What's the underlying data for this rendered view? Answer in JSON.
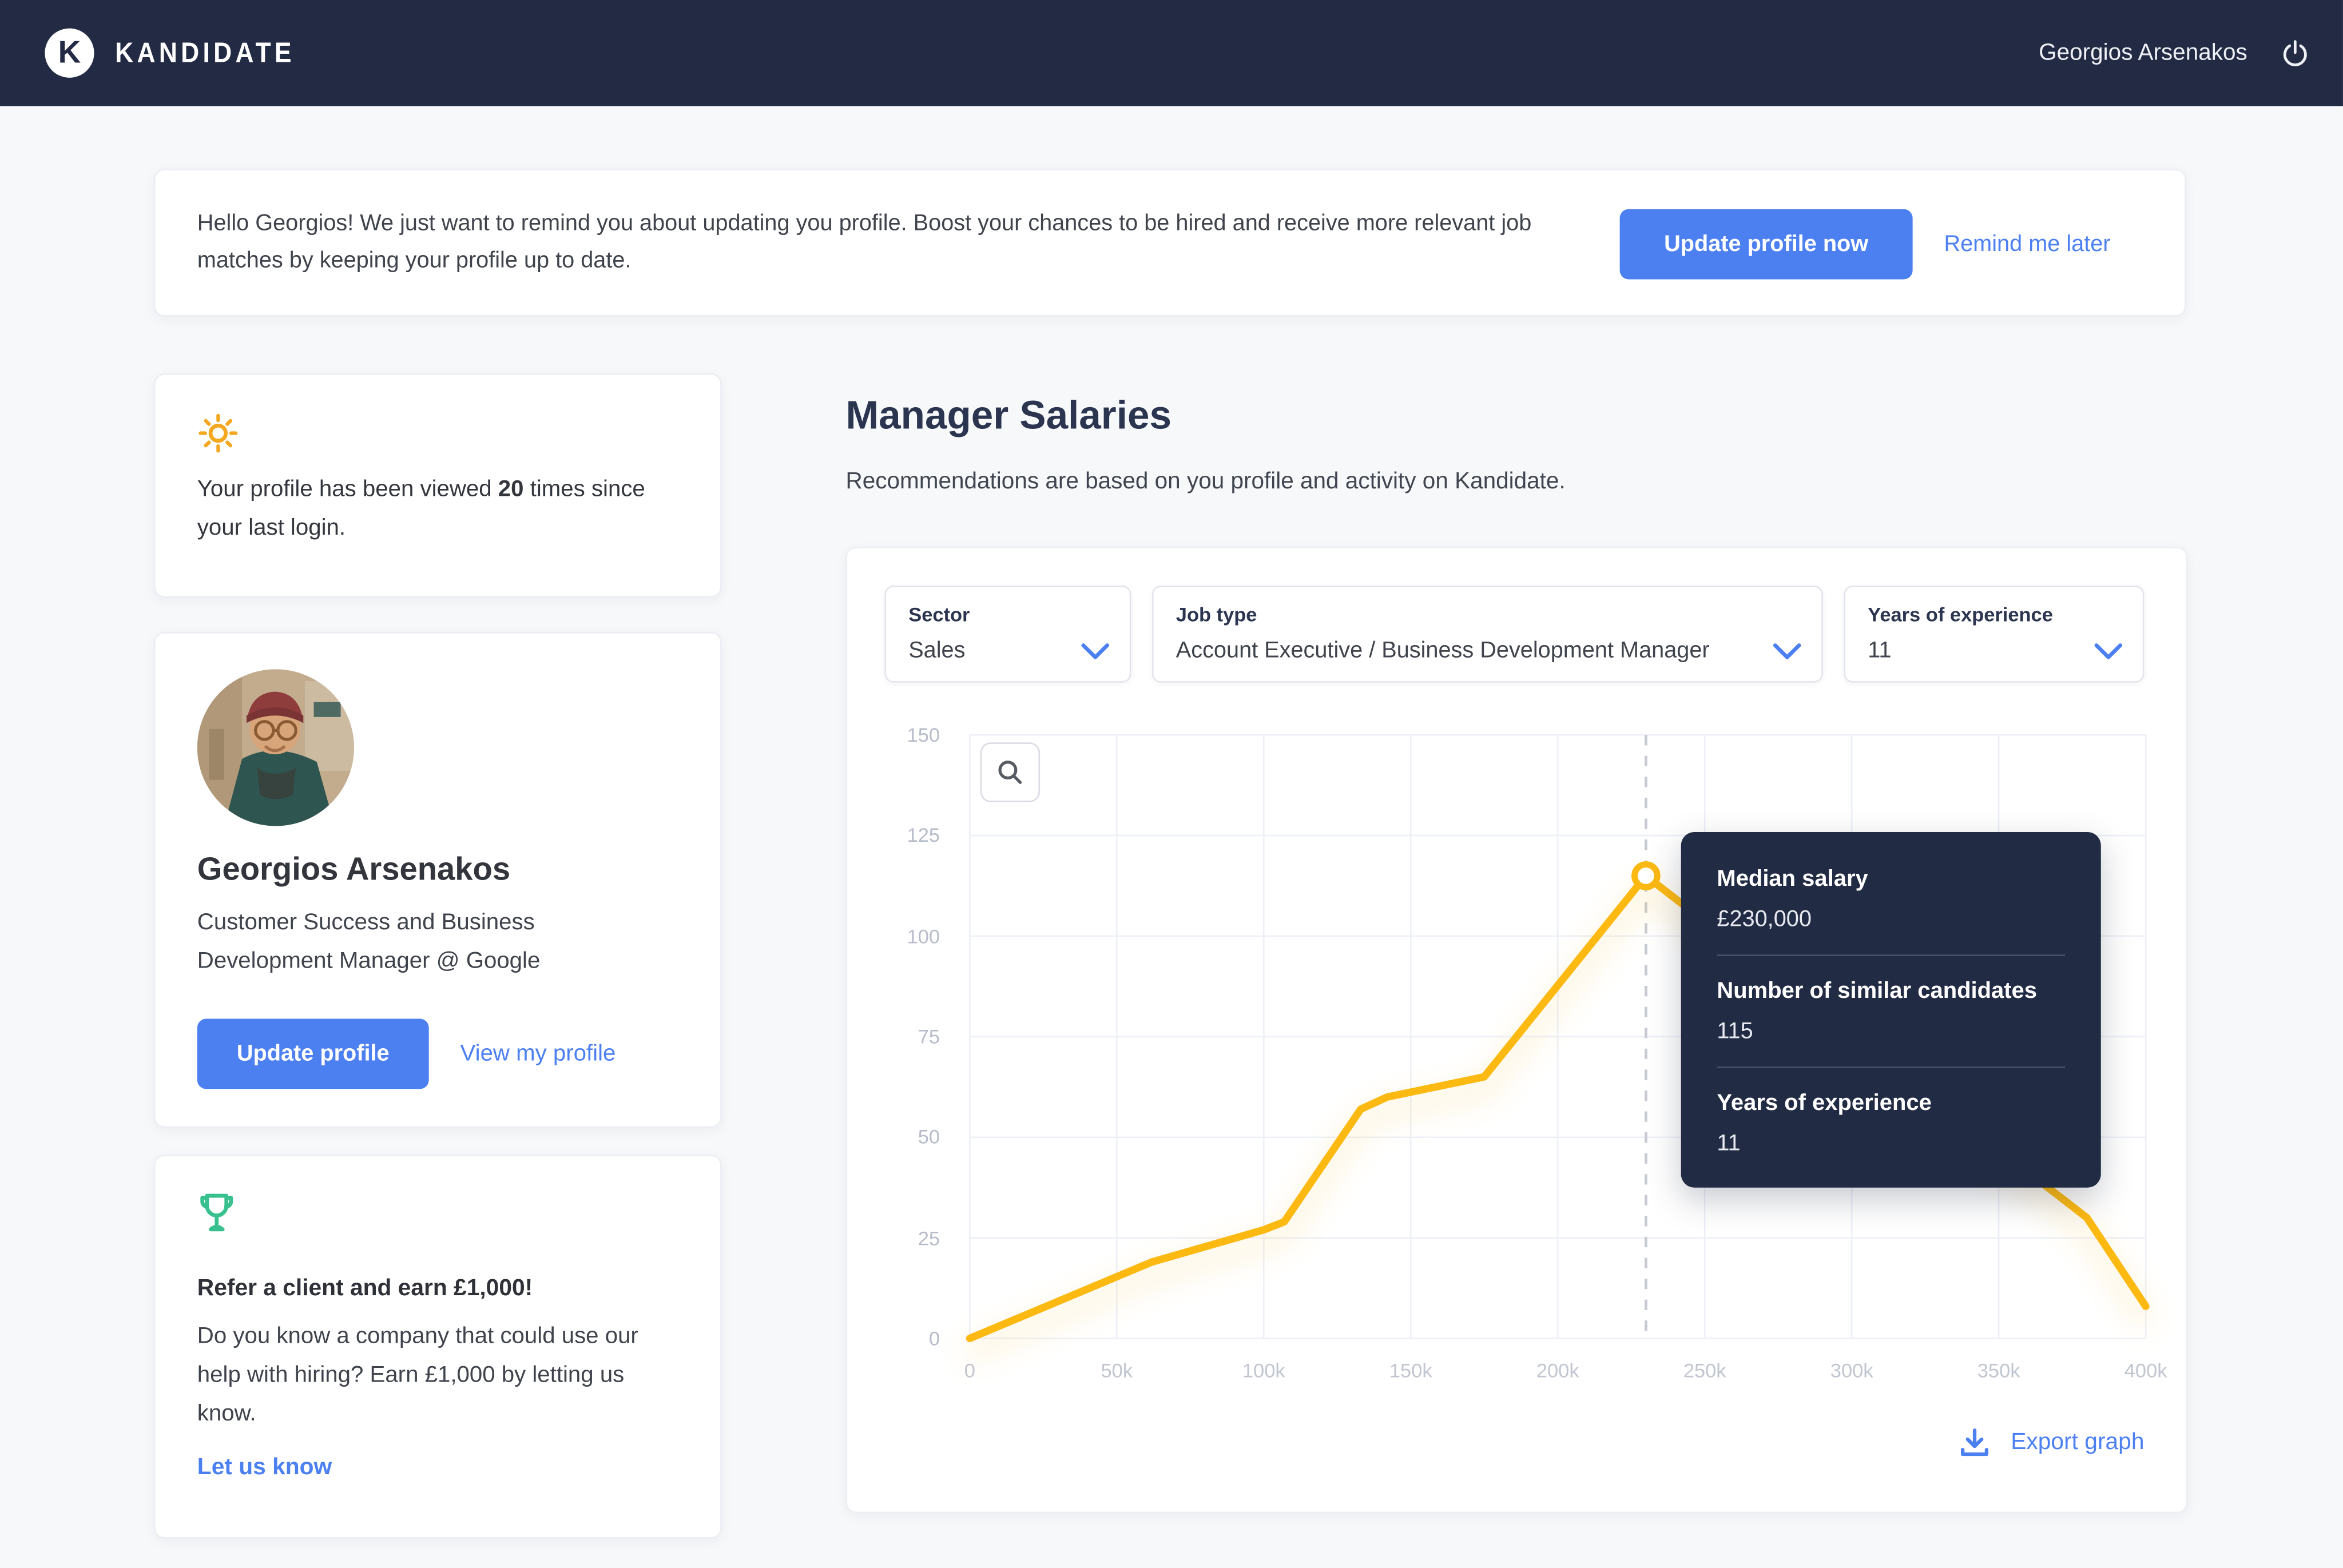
{
  "colors": {
    "navy": "#232b44",
    "accent_blue": "#4c80f1",
    "line_yellow": "#fcb912",
    "sun_orange": "#f3a81f",
    "trophy_green": "#38c18e"
  },
  "navbar": {
    "logo_letter": "K",
    "brand": "KANDIDATE",
    "user_name": "Georgios Arsenakos"
  },
  "banner": {
    "message": "Hello Georgios! We just want to remind you about updating you profile. Boost your chances to be hired and receive more relevant job matches by keeping your profile up to date.",
    "primary_button": "Update profile now",
    "secondary_link": "Remind me later"
  },
  "sidebar": {
    "views_card": {
      "text_before": "Your profile has been viewed ",
      "count": "20",
      "text_after": " times since your last login."
    },
    "profile_card": {
      "name": "Georgios Arsenakos",
      "title": "Customer Success and Business Development Manager @ Google",
      "primary_button": "Update profile",
      "secondary_link": "View my profile"
    },
    "referral_card": {
      "title": "Refer a client and earn £1,000!",
      "body": "Do you know a company that could use our help with hiring? Earn £1,000 by letting us know.",
      "link": "Let us know"
    }
  },
  "main": {
    "title": "Manager Salaries",
    "subtitle": "Recommendations are based on you profile and activity on Kandidate.",
    "filters": [
      {
        "label": "Sector",
        "value": "Sales"
      },
      {
        "label": "Job type",
        "value": "Account Executive / Business Development Manager"
      },
      {
        "label": "Years of experience",
        "value": "11"
      }
    ],
    "tooltip": {
      "rows": [
        {
          "label": "Median salary",
          "value": "£230,000"
        },
        {
          "label": "Number of similar candidates",
          "value": "115"
        },
        {
          "label": "Years of experience",
          "value": "11"
        }
      ]
    },
    "export_label": "Export graph"
  },
  "chart_data": {
    "type": "line",
    "title": "Manager Salaries",
    "x_ticks": [
      {
        "value": 0,
        "label": "0"
      },
      {
        "value": 50000,
        "label": "50k"
      },
      {
        "value": 100000,
        "label": "100k"
      },
      {
        "value": 150000,
        "label": "150k"
      },
      {
        "value": 200000,
        "label": "200k"
      },
      {
        "value": 250000,
        "label": "250k"
      },
      {
        "value": 300000,
        "label": "300k"
      },
      {
        "value": 350000,
        "label": "350k"
      },
      {
        "value": 400000,
        "label": "400k"
      }
    ],
    "y_ticks": [
      0,
      25,
      50,
      75,
      100,
      125,
      150
    ],
    "x_range": [
      0,
      400000
    ],
    "y_range": [
      0,
      150
    ],
    "grid": true,
    "legend": false,
    "points": [
      [
        0,
        0
      ],
      [
        62000,
        19
      ],
      [
        100000,
        27
      ],
      [
        107000,
        29
      ],
      [
        133000,
        57
      ],
      [
        142000,
        60
      ],
      [
        175000,
        65
      ],
      [
        230000,
        115
      ],
      [
        380000,
        30
      ],
      [
        400000,
        8
      ]
    ],
    "highlight": {
      "x": 230000,
      "y": 115,
      "median_salary": "£230,000",
      "similar_candidates": 115,
      "years_of_experience": 11
    }
  }
}
